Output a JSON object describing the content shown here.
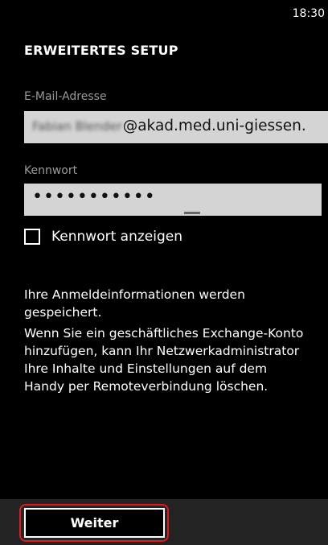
{
  "status_bar": {
    "time": "18:30"
  },
  "page": {
    "title": "ERWEITERTES SETUP"
  },
  "email": {
    "label": "E-Mail-Adresse",
    "value_blurred_part": "Fabian Blender",
    "value_domain": "@akad.med.uni-giessen."
  },
  "password": {
    "label": "Kennwort",
    "value_masked": "•••••••••••"
  },
  "show_password": {
    "label": "Kennwort anzeigen",
    "checked": false
  },
  "info": {
    "saved_text": "Ihre Anmeldeinformationen werden gespeichert.",
    "exchange_text": "Wenn Sie ein geschäftliches Exchange-Konto hinzufügen, kann Ihr Netzwerkadministrator Ihre Inhalte und Einstellungen auf dem Handy per Remoteverbindung löschen."
  },
  "app_bar": {
    "next_label": "Weiter"
  },
  "colors": {
    "background": "#000000",
    "textbox": "#d4d4d4",
    "app_bar": "#232323",
    "highlight": "#e01a1a"
  }
}
